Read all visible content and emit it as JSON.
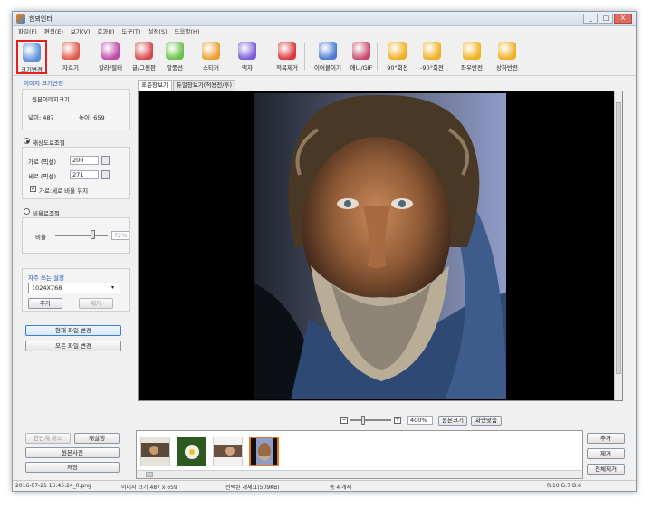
{
  "window": {
    "title": "한뫼인터"
  },
  "window_controls": {
    "minimize": "_",
    "maximize": "□",
    "close": "X"
  },
  "menu": [
    "파일(F)",
    "편집(E)",
    "보기(V)",
    "효과(I)",
    "도구(T)",
    "설정(S)",
    "도움말(H)"
  ],
  "toolbar": [
    {
      "label": "크기변경",
      "icon": "resize-icon",
      "color": "#5a8fd8",
      "active": true
    },
    {
      "label": "자르기",
      "icon": "crop-icon",
      "color": "#e0584a"
    },
    {
      "label": "칼라/필터",
      "icon": "color-filter-icon",
      "color": "#c04aa8"
    },
    {
      "label": "글/그림판",
      "icon": "text-draw-icon",
      "color": "#d8484a"
    },
    {
      "label": "말풍선",
      "icon": "speech-bubble-icon",
      "color": "#6cc04a"
    },
    {
      "label": "스티커",
      "icon": "sticker-icon",
      "color": "#e8a030"
    },
    {
      "label": "액자",
      "icon": "frame-icon",
      "color": "#7a5ad8"
    },
    {
      "label": "적목제거",
      "icon": "red-eye-icon",
      "color": "#d83a3a"
    },
    {
      "label": "이어붙이기",
      "icon": "merge-icon",
      "color": "#4a7ad0"
    },
    {
      "label": "애니/GIF",
      "icon": "gif-icon",
      "color": "#c84a6a"
    },
    {
      "label": "90°회전",
      "icon": "rotate-cw-icon",
      "color": "#f0b020"
    },
    {
      "label": "-90°회전",
      "icon": "rotate-ccw-icon",
      "color": "#f0b020"
    },
    {
      "label": "좌우반전",
      "icon": "flip-horizontal-icon",
      "color": "#f0b020"
    },
    {
      "label": "상하반전",
      "icon": "flip-vertical-icon",
      "color": "#f0b020"
    }
  ],
  "resize_panel": {
    "section_title": "이미지 크기변경",
    "original_size_title": "원본이미지크기",
    "width_label": "넓이: 487",
    "height_label": "높이: 659",
    "by_resolution_label": "해상도로조절",
    "width_px_label": "가로 (픽셀)",
    "width_px_value": "200",
    "height_px_label": "세로 (픽셀)",
    "height_px_value": "271",
    "keep_ratio_label": "가로:세로 비율 유지",
    "keep_ratio_checked": true,
    "by_ratio_label": "비율로조절",
    "ratio_label": "비율",
    "ratio_value": "72%",
    "ratio_fraction": 0.72,
    "presets_title": "자주 쓰는 설정",
    "preset_selected": "1024X768",
    "add_button": "추가",
    "remove_button": "제거",
    "apply_current_button": "현재 파일 변경",
    "apply_all_button": "모든 파일 변경"
  },
  "left_bottom": {
    "undo_button": "한단계 취소",
    "redo_button": "재실행",
    "original_button": "원본사진",
    "save_button": "저장"
  },
  "tabs": [
    "표준창보기",
    "듀얼창보기(적용전/후)"
  ],
  "zoom": {
    "value": "400%",
    "level_fraction": 0.3,
    "original_size_button": "원본크기",
    "fit_button": "화면맞춤"
  },
  "right_buttons": {
    "add": "추가",
    "remove": "제거",
    "remove_all": "전체제거"
  },
  "status": {
    "file": "2016-07-21 16:45:24_0.png",
    "image_size": "이미지 크기:487 x 659",
    "selected": "선택된 개체:1(509KB)",
    "total": "총 4 개체",
    "color": "R:10 G:7 B:6"
  },
  "colors": {
    "accent": "#1a4fb5",
    "active_border": "#e32020",
    "selected_thumb": "#e07a1a"
  }
}
